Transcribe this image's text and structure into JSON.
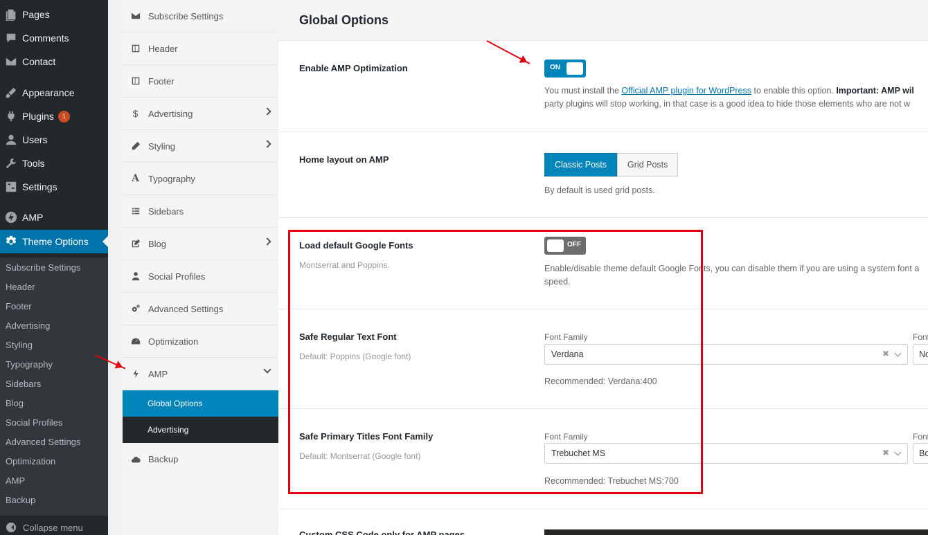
{
  "wp_menu": {
    "items": [
      {
        "label": "Pages",
        "icon": "pages-icon"
      },
      {
        "label": "Comments",
        "icon": "comments-icon"
      },
      {
        "label": "Contact",
        "icon": "mail-icon"
      },
      {
        "label": "Appearance",
        "icon": "brush-icon"
      },
      {
        "label": "Plugins",
        "icon": "plug-icon",
        "badge": "1"
      },
      {
        "label": "Users",
        "icon": "users-icon"
      },
      {
        "label": "Tools",
        "icon": "wrench-icon"
      },
      {
        "label": "Settings",
        "icon": "settings-icon"
      },
      {
        "label": "AMP",
        "icon": "amp-icon"
      },
      {
        "label": "Theme Options",
        "icon": "gear-icon"
      }
    ],
    "submenu": [
      "Subscribe Settings",
      "Header",
      "Footer",
      "Advertising",
      "Styling",
      "Typography",
      "Sidebars",
      "Blog",
      "Social Profiles",
      "Advanced Settings",
      "Optimization",
      "AMP",
      "Backup"
    ],
    "collapse_label": "Collapse menu"
  },
  "options_nav": {
    "items": [
      {
        "label": "Subscribe Settings",
        "icon": "envelope-icon"
      },
      {
        "label": "Header",
        "icon": "layout-icon"
      },
      {
        "label": "Footer",
        "icon": "layout-icon"
      },
      {
        "label": "Advertising",
        "icon": "dollar-icon"
      },
      {
        "label": "Styling",
        "icon": "pencil-icon"
      },
      {
        "label": "Typography",
        "icon": "font-icon"
      },
      {
        "label": "Sidebars",
        "icon": "list-icon"
      },
      {
        "label": "Blog",
        "icon": "edit-icon"
      },
      {
        "label": "Social Profiles",
        "icon": "user-icon"
      },
      {
        "label": "Advanced Settings",
        "icon": "cogs-icon"
      },
      {
        "label": "Optimization",
        "icon": "dashboard-icon"
      },
      {
        "label": "AMP",
        "icon": "bolt-icon"
      },
      {
        "label": "Backup",
        "icon": "cloud-icon"
      }
    ],
    "amp_sub": [
      "Global Options",
      "Advertising"
    ]
  },
  "main": {
    "title": "Global Options",
    "enable_amp": {
      "label": "Enable AMP Optimization",
      "switch": "ON",
      "desc_1_pre": "You must install the ",
      "desc_1_link": "Official AMP plugin for WordPress",
      "desc_1_post": " to enable this option. ",
      "desc_1_bold": "Important: AMP wil",
      "desc_2": "party plugins will stop working, in that case is a good idea to hide those elements who are not w"
    },
    "home_layout": {
      "label": "Home layout on AMP",
      "options": [
        "Classic Posts",
        "Grid Posts"
      ],
      "desc": "By default is used grid posts."
    },
    "google_fonts": {
      "label": "Load default Google Fonts",
      "sub": "Montserrat and Poppins.",
      "switch": "OFF",
      "desc_1": "Enable/disable theme default Google Fonts, you can disable them if you are using a system font a",
      "desc_2": "speed."
    },
    "regular_font": {
      "label": "Safe Regular Text Font",
      "sub": "Default: Poppins (Google font)",
      "field_label": "Font Family",
      "field2_label": "Font",
      "value": "Verdana",
      "value2": "No",
      "recommended": "Recommended: Verdana:400"
    },
    "titles_font": {
      "label": "Safe Primary Titles Font Family",
      "sub": "Default: Montserrat (Google font)",
      "field_label": "Font Family",
      "field2_label": "Font",
      "value": "Trebuchet MS",
      "value2": "Bo",
      "recommended": "Recommended: Trebuchet MS:700"
    },
    "custom_css_label": "Custom CSS Code only for AMP pages"
  },
  "colors": {
    "accent": "#0085ba",
    "wp_dark": "#23282d",
    "annotation": "#e3000f"
  }
}
